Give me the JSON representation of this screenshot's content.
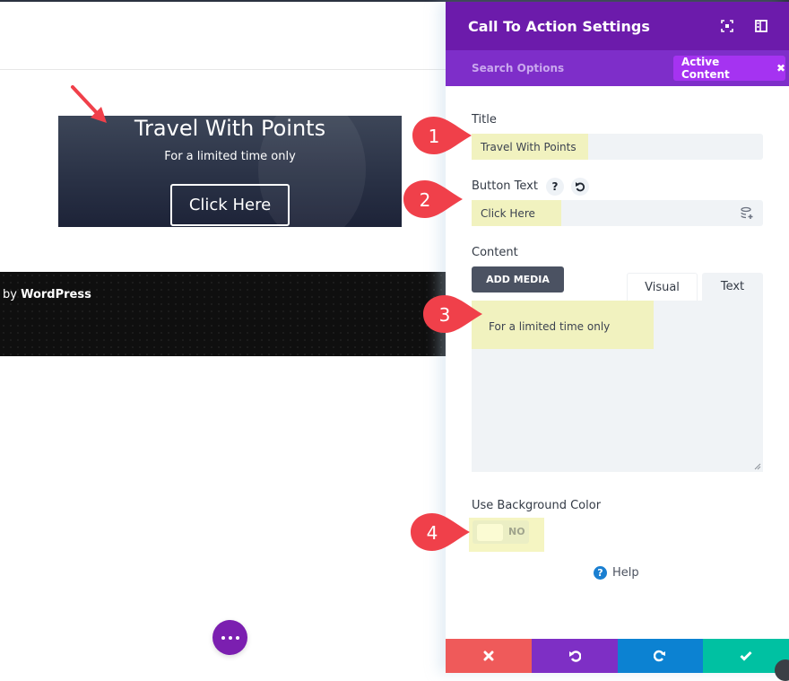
{
  "preview": {
    "cta": {
      "title": "Travel With Points",
      "content": "For a limited time only",
      "button_label": "Click Here"
    },
    "footer": {
      "credit_prefix": "by ",
      "credit_brand": "WordPress"
    },
    "fab_icon": "more-dots-icon"
  },
  "panel": {
    "title": "Call To Action Settings",
    "header_icons": [
      "fullscreen-icon",
      "split-view-icon"
    ],
    "search_placeholder": "Search Options",
    "filter_chip": {
      "label": "Active Content",
      "close_glyph": "✖"
    },
    "fields": {
      "title": {
        "label": "Title",
        "value": "Travel With Points"
      },
      "button_text": {
        "label": "Button Text",
        "help_glyph": "?",
        "value": "Click Here"
      },
      "content": {
        "label": "Content",
        "add_media_label": "ADD MEDIA",
        "tabs": [
          {
            "label": "Visual",
            "active": false
          },
          {
            "label": "Text",
            "active": true
          }
        ],
        "value": "For a limited time only"
      },
      "use_background_color": {
        "label": "Use Background Color",
        "state_label": "NO",
        "enabled": false
      }
    },
    "help": {
      "glyph": "?",
      "label": "Help"
    },
    "footer_buttons": [
      {
        "name": "cancel",
        "icon": "close-icon",
        "color": "#ef5a5a"
      },
      {
        "name": "undo",
        "icon": "undo-icon",
        "color": "#7e2fc5"
      },
      {
        "name": "redo",
        "icon": "redo-icon",
        "color": "#0c82d2"
      },
      {
        "name": "save",
        "icon": "check-icon",
        "color": "#00c1a2"
      }
    ]
  },
  "annotations": {
    "badges": [
      "1",
      "2",
      "3",
      "4"
    ],
    "badge_color": "#f0404a",
    "highlight_color": "#f1f2bf"
  },
  "colors": {
    "panel_header": "#6c1bab",
    "panel_subheader": "#7e2ec9",
    "chip": "#a533f1",
    "fab": "#7b1fb0"
  }
}
